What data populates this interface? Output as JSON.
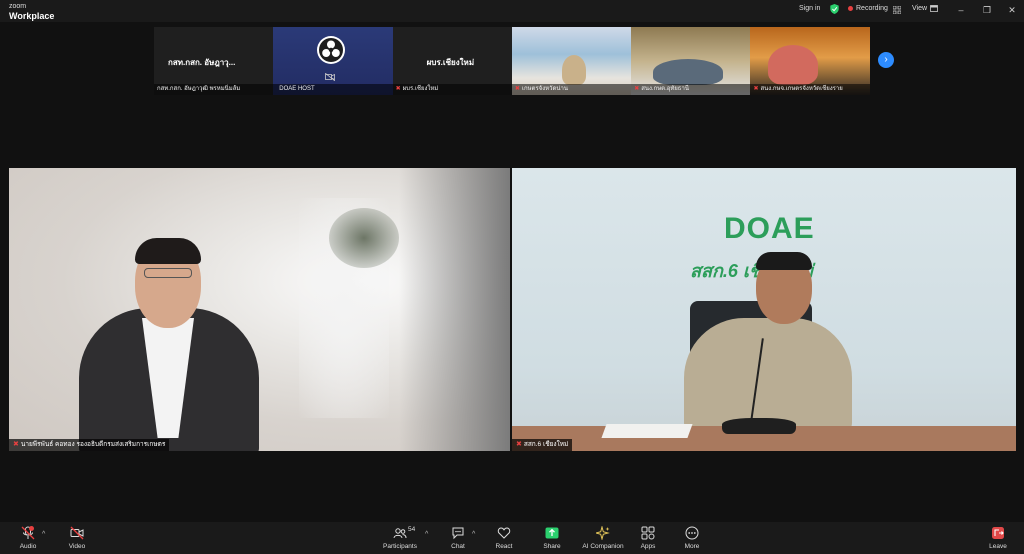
{
  "app": {
    "brand_top": "zoom",
    "brand_bottom": "Workplace"
  },
  "titlebar": {
    "signin": "Sign in",
    "recording": "Recording",
    "view": "View",
    "minimize": "–",
    "restore": "❐",
    "close": "✕"
  },
  "strip": {
    "tiles": [
      {
        "title": "กสท.กสก. อัษฎาวุ...",
        "label": "กสท.กสก. อัษฎาวุฒิ พรหมนิ่มส้ม"
      },
      {
        "title": "",
        "label": "DOAE HOST"
      },
      {
        "title": "ผบร.เชียงใหม่",
        "label": "ผบร.เชียงใหม่"
      },
      {
        "title": "",
        "label": "เกษตรจังหวัดน่าน"
      },
      {
        "title": "",
        "label": "สนง.กษต.อุทัยธานี"
      },
      {
        "title": "",
        "label": "สนง.กษจ.เกษตรจังหวัดเชียงราย"
      }
    ],
    "next_label": "›"
  },
  "videos": {
    "left": {
      "name": "นายพีรพันธ์ คอทอง รองอธิบดีกรมส่งเสริมการเกษตร"
    },
    "right": {
      "name": "สสก.6 เชียงใหม่",
      "wall_logo": "DOAE",
      "wall_sub": "สสก.6 เชียงใหม่"
    }
  },
  "toolbar": {
    "audio": "Audio",
    "video": "Video",
    "participants": "Participants",
    "participants_count": "54",
    "chat": "Chat",
    "react": "React",
    "share": "Share",
    "ai": "AI Companion",
    "apps": "Apps",
    "more": "More",
    "leave": "Leave"
  },
  "colors": {
    "accent": "#2d8cff",
    "active_border": "#3fd07a",
    "share_green": "#2bd06e",
    "mute_red": "#e84040"
  }
}
